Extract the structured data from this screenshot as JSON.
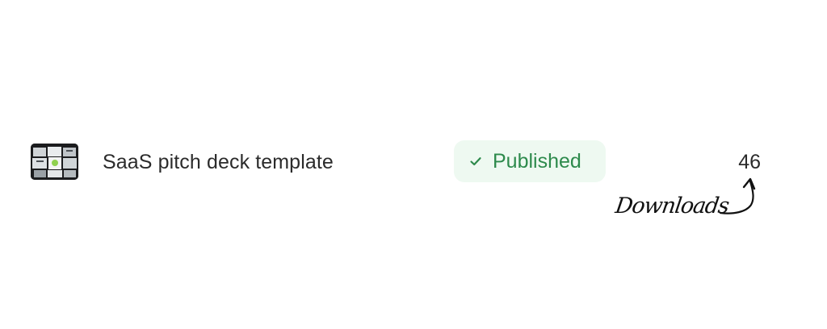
{
  "row": {
    "title": "SaaS pitch deck template",
    "status": {
      "label": "Published",
      "icon": "check-icon",
      "text_color": "#2d8a4c",
      "background_color": "#eef9f1"
    },
    "count": "46"
  },
  "annotation": {
    "text": "Downloads",
    "icon": "curved-arrow-icon"
  }
}
